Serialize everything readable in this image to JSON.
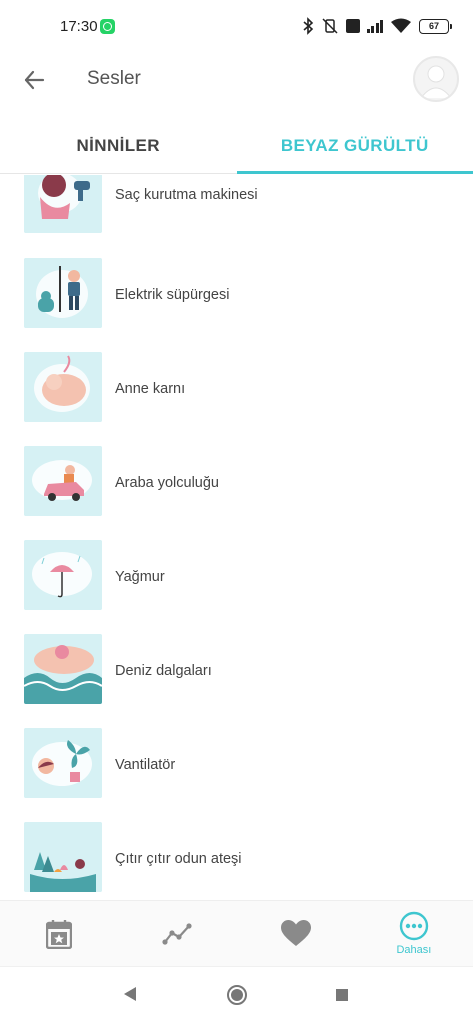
{
  "status_bar": {
    "time": "17:30",
    "battery": "67"
  },
  "app_bar": {
    "title": "Sesler"
  },
  "tabs": [
    {
      "label": "NİNNİLER",
      "active": false
    },
    {
      "label": "BEYAZ GÜRÜLTÜ",
      "active": true
    }
  ],
  "sounds": [
    {
      "label": "Saç kurutma makinesi",
      "icon": "hair-dryer-icon"
    },
    {
      "label": "Elektrik süpürgesi",
      "icon": "vacuum-cleaner-icon"
    },
    {
      "label": "Anne karnı",
      "icon": "womb-icon"
    },
    {
      "label": "Araba yolculuğu",
      "icon": "car-ride-icon"
    },
    {
      "label": "Yağmur",
      "icon": "rain-umbrella-icon"
    },
    {
      "label": "Deniz dalgaları",
      "icon": "sea-waves-icon"
    },
    {
      "label": "Vantilatör",
      "icon": "fan-icon"
    },
    {
      "label": "Çıtır çıtır odun ateşi",
      "icon": "campfire-icon"
    }
  ],
  "bottom_nav": {
    "more_label": "Dahası"
  },
  "colors": {
    "accent": "#3ec6cf",
    "thumb_bg": "#d6f1f4",
    "icon_gray": "#8a8a8a"
  }
}
